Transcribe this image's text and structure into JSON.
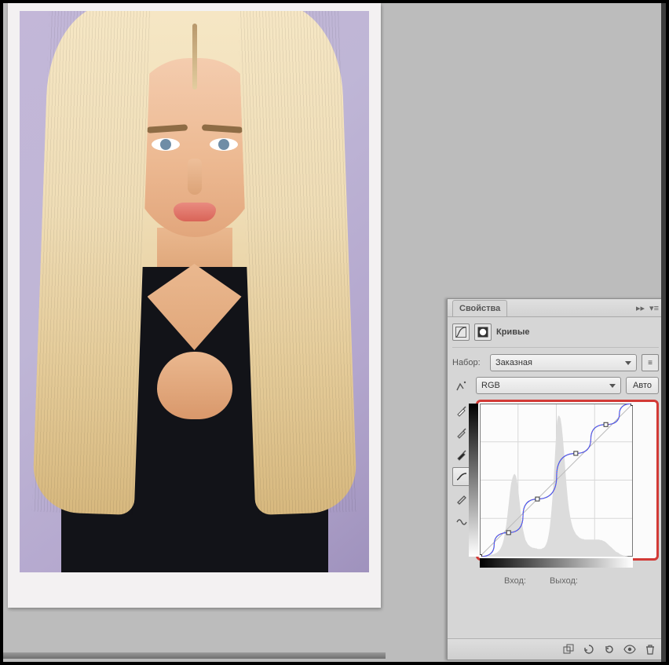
{
  "panel": {
    "tab_label": "Свойства",
    "adjustment_title": "Кривые",
    "preset_label": "Набор:",
    "preset_value": "Заказная",
    "channel_value": "RGB",
    "auto_label": "Авто",
    "input_label": "Вход:",
    "output_label": "Выход:"
  },
  "tools": {
    "finger": "target-adjust",
    "sampler_white": "white-point",
    "sampler_gray": "gray-point",
    "sampler_black": "black-point",
    "curve": "curve-tool",
    "pencil": "pencil-tool",
    "smooth": "smooth-tool"
  },
  "footer_icons": [
    "clip-to-layer",
    "view-previous",
    "reset",
    "visibility",
    "delete"
  ],
  "chart_data": {
    "type": "line",
    "title": "Кривые",
    "xlabel": "Вход",
    "ylabel": "Выход",
    "xlim": [
      0,
      255
    ],
    "ylim": [
      0,
      255
    ],
    "grid": true,
    "curve_points": [
      {
        "x": 0,
        "y": 0
      },
      {
        "x": 48,
        "y": 40
      },
      {
        "x": 96,
        "y": 96
      },
      {
        "x": 160,
        "y": 172
      },
      {
        "x": 210,
        "y": 220
      },
      {
        "x": 255,
        "y": 255
      }
    ],
    "histogram": [
      0,
      0,
      0,
      0,
      1,
      1,
      2,
      2,
      3,
      3,
      4,
      4,
      5,
      6,
      7,
      9,
      11,
      14,
      18,
      24,
      32,
      44,
      58,
      76,
      96,
      116,
      132,
      142,
      148,
      150,
      146,
      136,
      120,
      100,
      80,
      62,
      48,
      38,
      30,
      26,
      22,
      20,
      18,
      17,
      16,
      16,
      15,
      15,
      14,
      14,
      14,
      14,
      15,
      16,
      18,
      22,
      28,
      38,
      52,
      72,
      98,
      130,
      168,
      208,
      244,
      255,
      255,
      250,
      236,
      214,
      186,
      156,
      128,
      104,
      86,
      72,
      62,
      54,
      48,
      44,
      40,
      38,
      36,
      34,
      33,
      32,
      32,
      31,
      31,
      31,
      31,
      31,
      31,
      31,
      31,
      31,
      31,
      31,
      31,
      31,
      30,
      30,
      29,
      28,
      27,
      25,
      23,
      21,
      19,
      17,
      15,
      13,
      11,
      9,
      8,
      7,
      5,
      4,
      3,
      2,
      2,
      1,
      1,
      0,
      0,
      0,
      0,
      0
    ]
  }
}
